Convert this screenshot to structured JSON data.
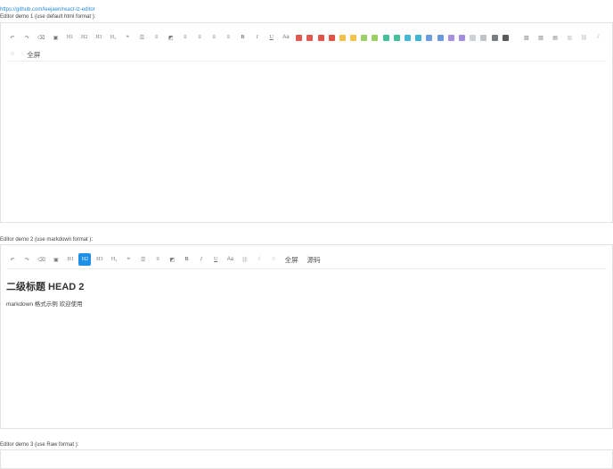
{
  "link": "https://github.com/leejaen/react-lz-editor",
  "demo1": {
    "label": "Editor demo 1 (use default html format ):",
    "fullscreen_label": "全屏"
  },
  "demo2": {
    "label": "Editor demo 2 (use markdown format ):",
    "fullscreen_label": "全屏",
    "source_label": "源码",
    "heading": "二级标题 HEAD 2",
    "paragraph": "markdown 格式示例 欢迎使用"
  },
  "demo3": {
    "label": "Editor demo 3 (use Raw format ):"
  },
  "toolbar": {
    "undo": "↶",
    "redo": "↷",
    "clear": "⌫",
    "paste": "▣",
    "h1": "H1",
    "h2": "H2",
    "h3": "H3",
    "h4": "H₄",
    "quote": "❝",
    "ul": "☰",
    "ol": "≡",
    "code": "◩",
    "align_left": "≡",
    "align_center": "≡",
    "align_right": "≡",
    "align_justify": "≡",
    "bold": "B",
    "italic": "I",
    "underline": "U",
    "font_color": "Aa",
    "image": "▨",
    "image2": "▧",
    "video": "▤",
    "audio": "▥",
    "link": "⛓",
    "unlink": "⫽",
    "emoji": "☺"
  },
  "colors": [
    "#e05a4f",
    "#e05a4f",
    "#e0544a",
    "#e05349",
    "#f2c14b",
    "#f3c44d",
    "#9bd166",
    "#9ad066",
    "#44c19b",
    "#43bf9b",
    "#43b7d4",
    "#3fb4d3",
    "#6c9be0",
    "#6a98df",
    "#a790e0",
    "#a48ddf",
    "#cfd2d5",
    "#c2c5c8",
    "#7b7e81",
    "#585b5e"
  ]
}
